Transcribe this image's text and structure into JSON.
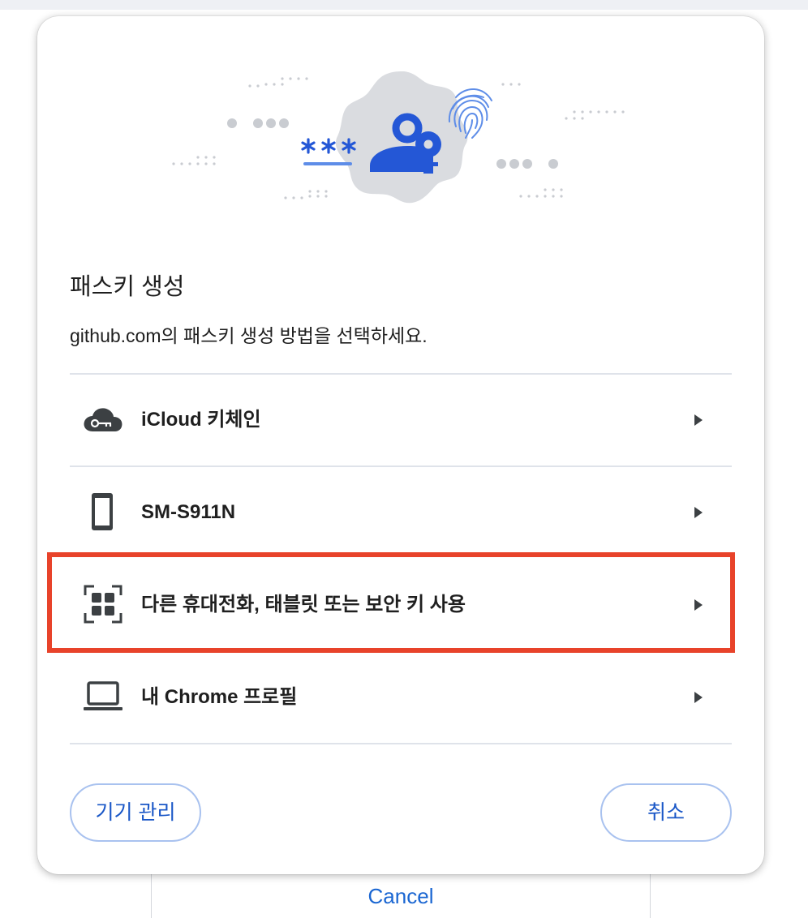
{
  "dialog": {
    "title": "패스키 생성",
    "subtitle": "github.com의 패스키 생성 방법을 선택하세요.",
    "options": [
      {
        "label": "iCloud 키체인",
        "icon": "cloud-key-icon"
      },
      {
        "label": "SM-S911N",
        "icon": "phone-icon"
      },
      {
        "label": "다른 휴대전화, 태블릿 또는 보안 키 사용",
        "icon": "qr-code-icon"
      },
      {
        "label": "내 Chrome 프로필",
        "icon": "laptop-icon"
      }
    ],
    "manage_button": "기기 관리",
    "cancel_button": "취소"
  },
  "background": {
    "cancel_link": "Cancel"
  },
  "colors": {
    "accent": "#1a57c7",
    "illustration_blue": "#2457d6",
    "highlight": "#e8432a",
    "badge_gray": "#dadce0"
  }
}
